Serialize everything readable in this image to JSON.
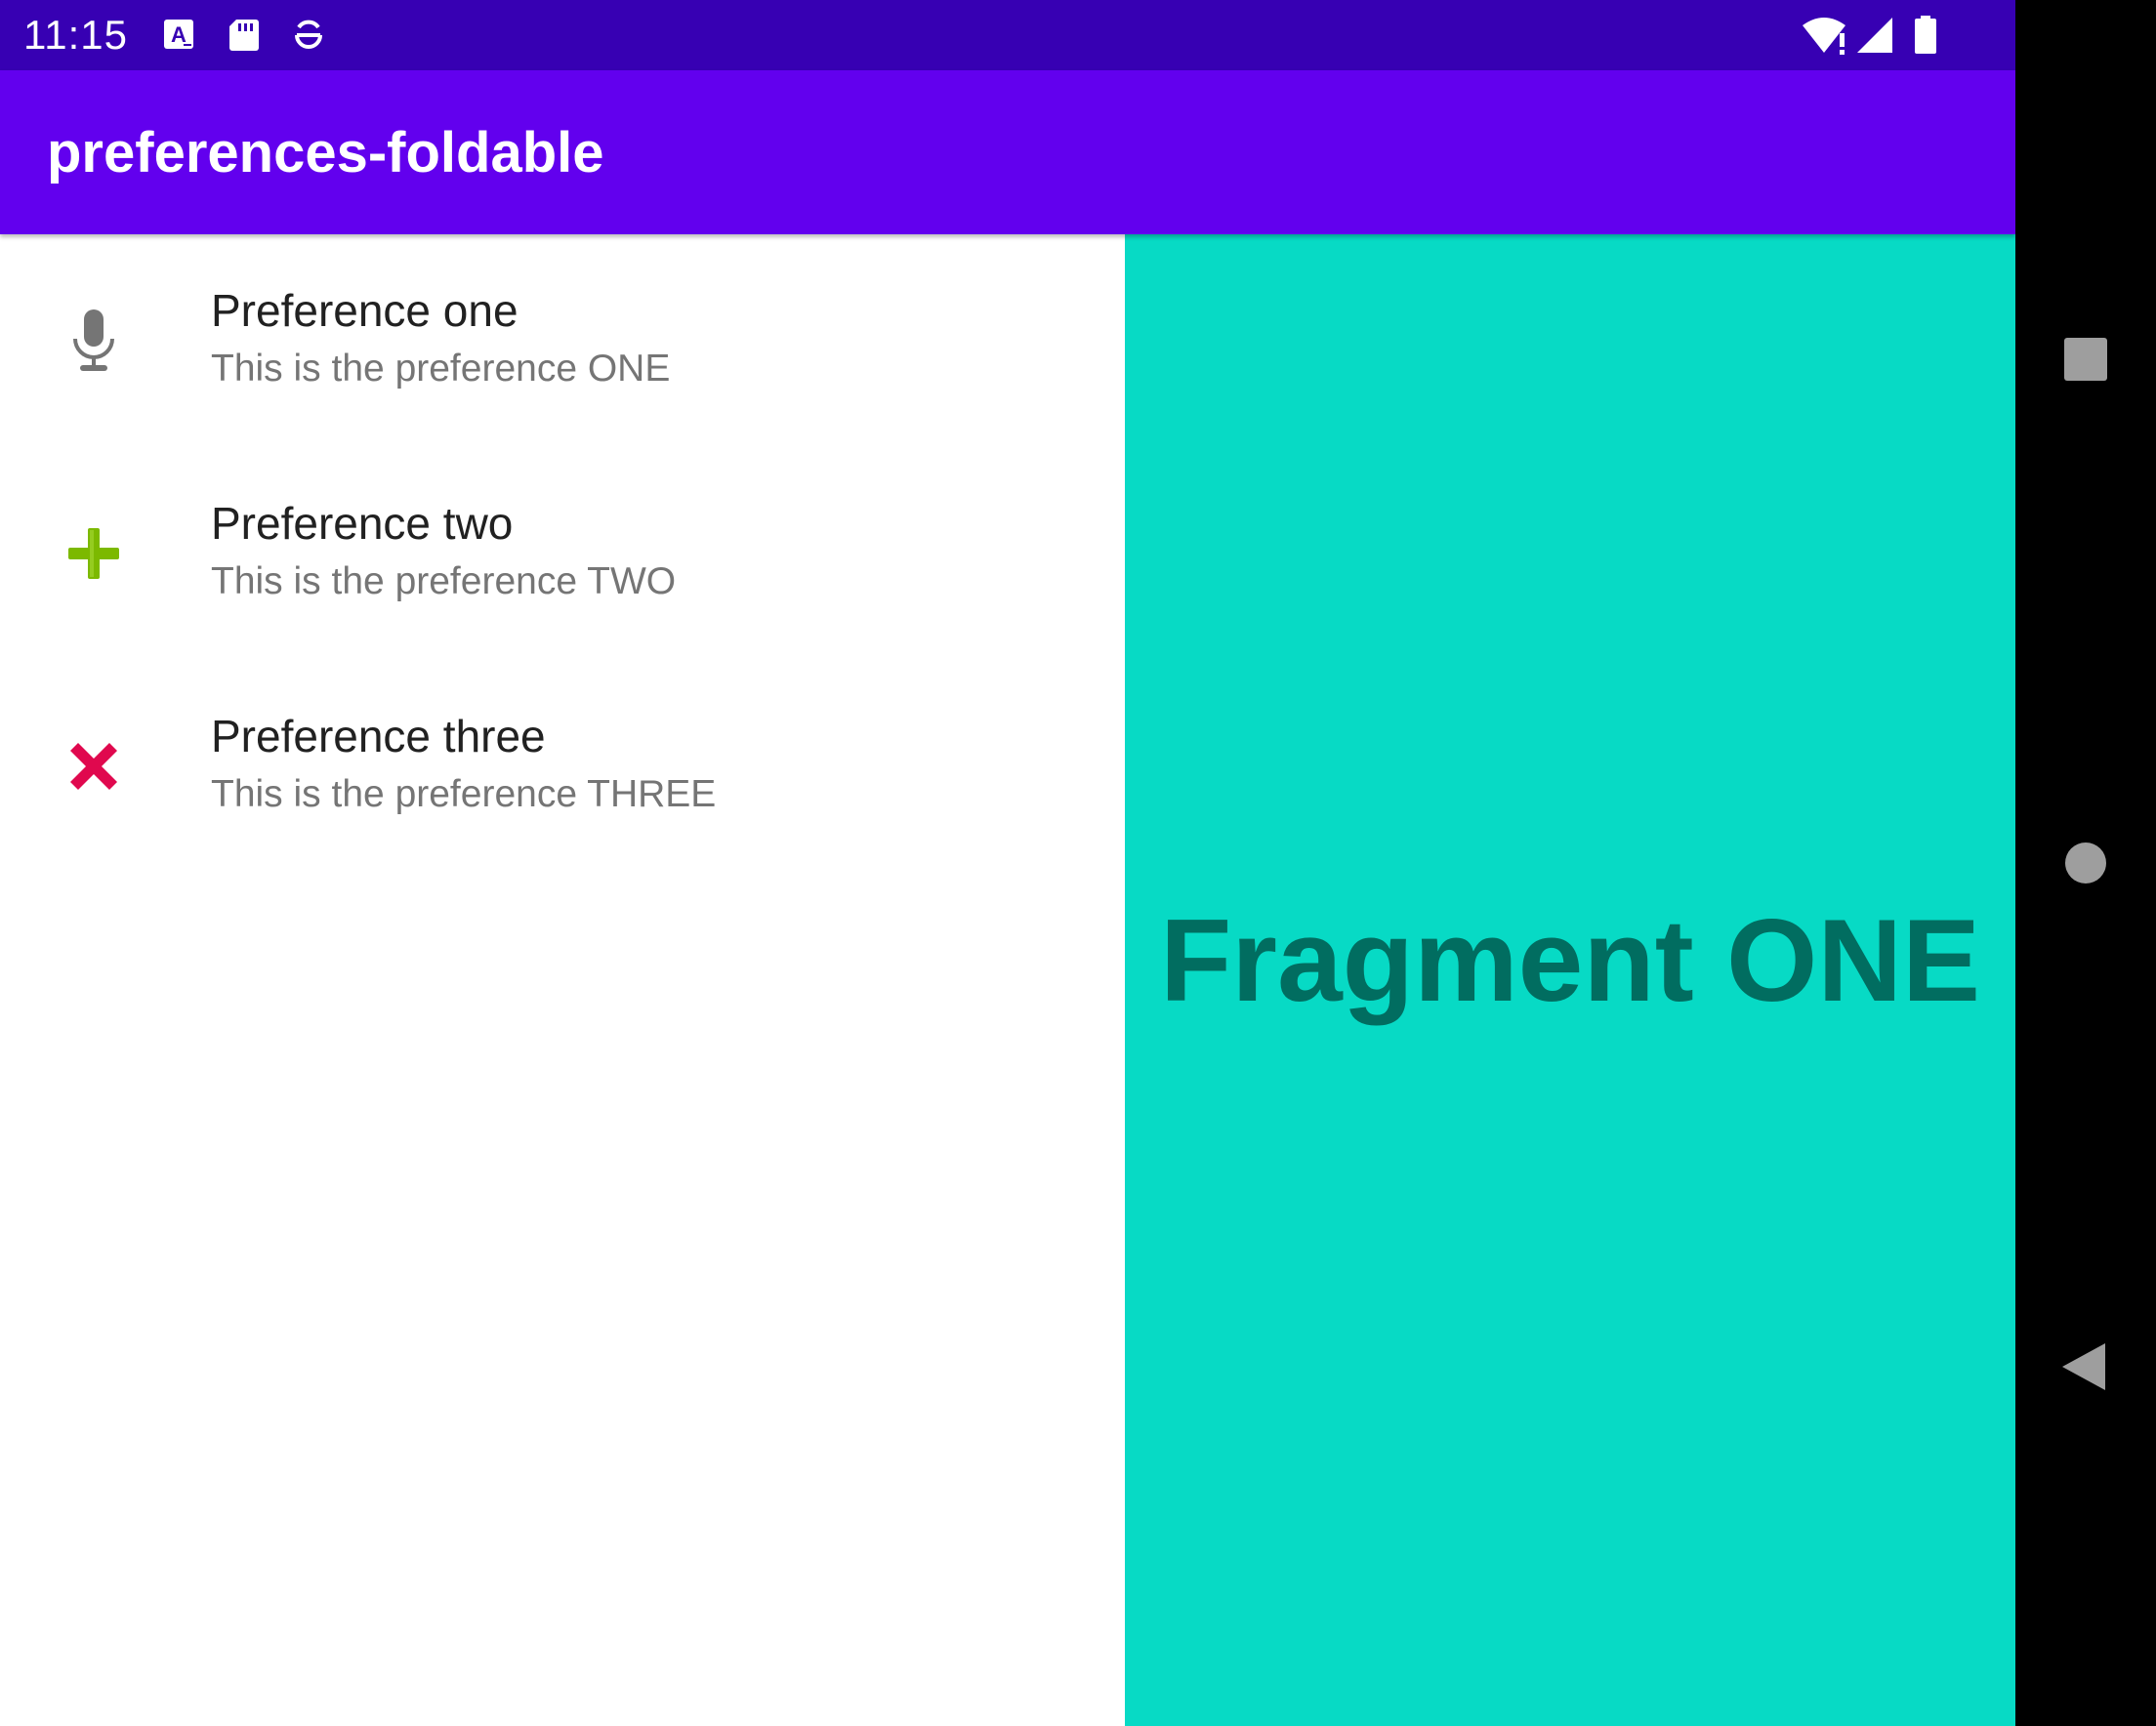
{
  "status_bar": {
    "time": "11:15",
    "left_icons": [
      "text-a-notification-icon",
      "sd-card-icon",
      "vpn-lock-icon"
    ],
    "right_icons": [
      "wifi-alert-icon",
      "cell-signal-icon",
      "battery-icon"
    ]
  },
  "app_bar": {
    "title": "preferences-foldable"
  },
  "preferences": [
    {
      "title": "Preference one",
      "summary": "This is the preference ONE",
      "icon": "microphone-icon",
      "icon_color": "#757575"
    },
    {
      "title": "Preference two",
      "summary": "This is the preference TWO",
      "icon": "plus-icon",
      "icon_color": "#7cb900"
    },
    {
      "title": "Preference three",
      "summary": "This is the preference THREE",
      "icon": "close-x-icon",
      "icon_color": "#e0084e"
    }
  ],
  "fragment": {
    "text": "Fragment ONE",
    "background": "#07dac5",
    "text_color": "#016d60"
  },
  "nav_bar": {
    "buttons": [
      "recents-square-icon",
      "home-circle-icon",
      "back-triangle-icon"
    ]
  },
  "colors": {
    "status_bar": "#3700b3",
    "app_bar": "#6200ee"
  }
}
